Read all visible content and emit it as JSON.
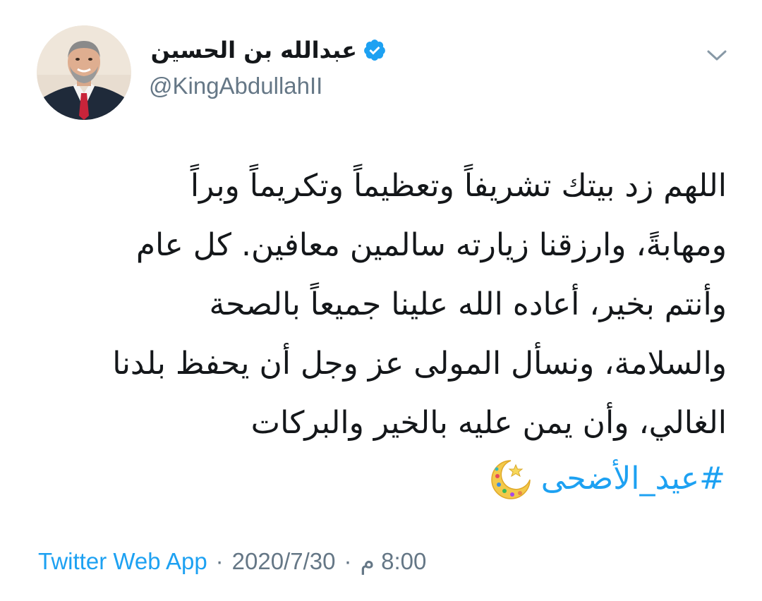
{
  "author": {
    "display_name": "عبدالله بن الحسين",
    "handle": "@KingAbdullahII",
    "verified": true,
    "avatar_icon": "profile-photo"
  },
  "tweet": {
    "lines": [
      "اللهم زد بيتك تشريفاً وتعظيماً وتكريماً وبراً",
      "ومهابةً، وارزقنا زيارته سالمين معافين. كل عام",
      "وأنتم بخير، أعاده الله علينا جميعاً بالصحة",
      "والسلامة، ونسأل المولى عز وجل أن يحفظ بلدنا",
      "الغالي، وأن يمن عليه بالخير والبركات"
    ],
    "hashtag": "#عيد_الأضحى",
    "hashtag_emoji": "crescent-moon-star-emoji"
  },
  "meta": {
    "source": "Twitter Web App",
    "separator": "·",
    "date": "2020/7/30",
    "time": "8:00 م"
  },
  "colors": {
    "link": "#1da1f2",
    "secondary": "#657786",
    "text": "#14171a"
  },
  "icons": {
    "verified": "verified-badge-icon",
    "menu": "chevron-down-icon"
  }
}
